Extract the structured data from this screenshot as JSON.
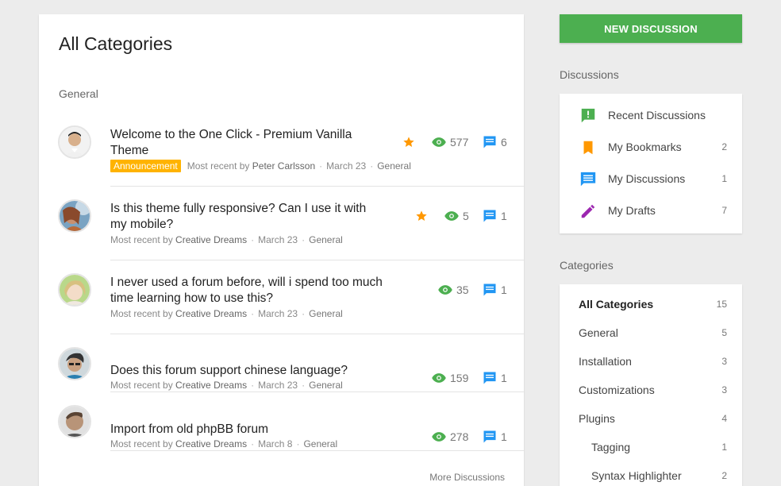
{
  "main": {
    "title": "All Categories",
    "section": "General",
    "more_label": "More Discussions",
    "discussions": [
      {
        "title": "Welcome to the One Click - Premium Vanilla Theme",
        "badge": "Announcement",
        "meta_prefix": "Most recent by",
        "author": "Peter Carlsson",
        "date": "March 23",
        "category": "General",
        "bookmarked": true,
        "views": "577",
        "comments": "6"
      },
      {
        "title": "Is this theme fully responsive? Can I use it with my mobile?",
        "meta_prefix": "Most recent by",
        "author": "Creative Dreams",
        "date": "March 23",
        "category": "General",
        "bookmarked": true,
        "views": "5",
        "comments": "1"
      },
      {
        "title": "I never used a forum before, will i spend too much time learning how to use this?",
        "meta_prefix": "Most recent by",
        "author": "Creative Dreams",
        "date": "March 23",
        "category": "General",
        "bookmarked": false,
        "views": "35",
        "comments": "1"
      },
      {
        "title": "Does this forum support chinese language?",
        "meta_prefix": "Most recent by",
        "author": "Creative Dreams",
        "date": "March 23",
        "category": "General",
        "bookmarked": false,
        "views": "159",
        "comments": "1"
      },
      {
        "title": "Import from old phpBB forum",
        "meta_prefix": "Most recent by",
        "author": "Creative Dreams",
        "date": "March 8",
        "category": "General",
        "bookmarked": false,
        "views": "278",
        "comments": "1"
      }
    ]
  },
  "sidebar": {
    "new_discussion_label": "NEW DISCUSSION",
    "discussions_heading": "Discussions",
    "discussion_links": [
      {
        "label": "Recent Discussions",
        "count": "",
        "icon": "alert-comment-icon",
        "color": "#4caf50"
      },
      {
        "label": "My Bookmarks",
        "count": "2",
        "icon": "bookmark-icon",
        "color": "#ff9800"
      },
      {
        "label": "My Discussions",
        "count": "1",
        "icon": "comment-icon",
        "color": "#2196f3"
      },
      {
        "label": "My Drafts",
        "count": "7",
        "icon": "pencil-icon",
        "color": "#9c27b0"
      }
    ],
    "categories_heading": "Categories",
    "categories": [
      {
        "label": "All Categories",
        "count": "15"
      },
      {
        "label": "General",
        "count": "5"
      },
      {
        "label": "Installation",
        "count": "3"
      },
      {
        "label": "Customizations",
        "count": "3"
      },
      {
        "label": "Plugins",
        "count": "4"
      },
      {
        "label": "Tagging",
        "count": "1"
      },
      {
        "label": "Syntax Highlighter",
        "count": "2"
      }
    ]
  },
  "colors": {
    "accent_green": "#4caf50",
    "star_orange": "#ff9800",
    "comment_blue": "#2196f3",
    "badge_yellow": "#ffb300"
  }
}
